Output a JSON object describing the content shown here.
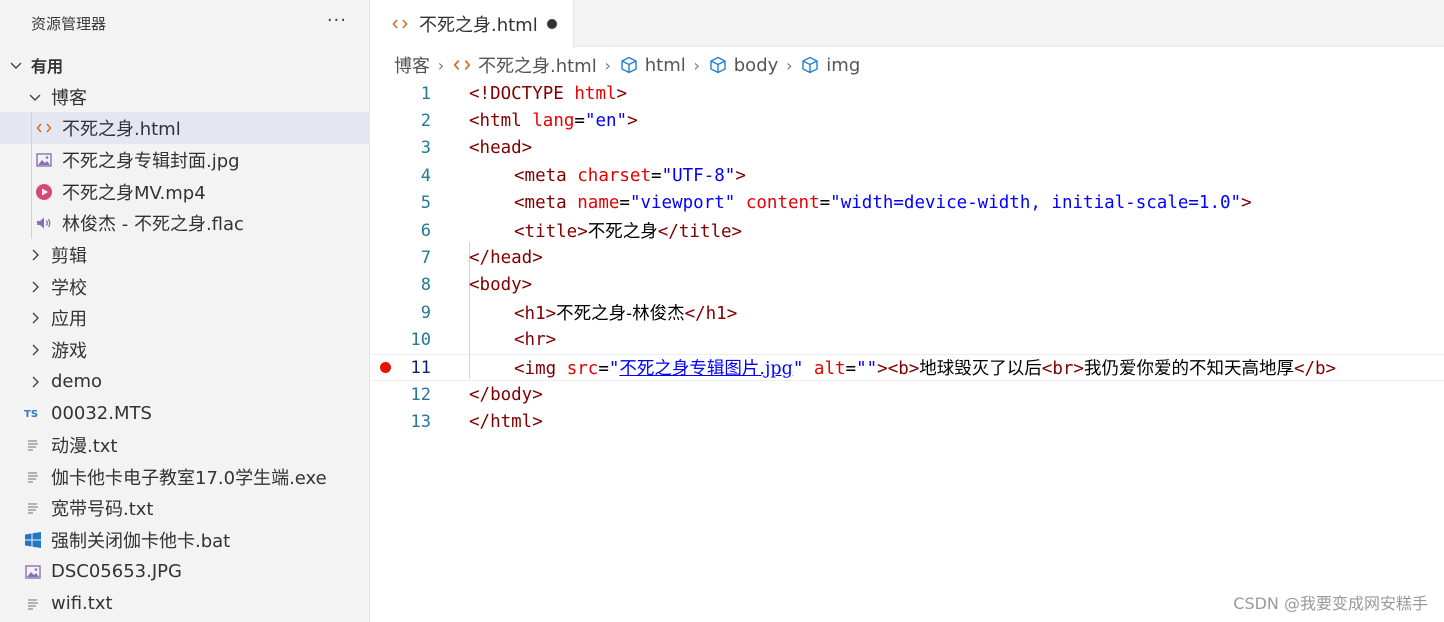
{
  "explorer": {
    "title": "资源管理器",
    "more": "···",
    "root": {
      "label": "有用"
    },
    "folder_blog": {
      "label": "博客"
    },
    "files_blog": [
      {
        "label": "不死之身.html",
        "icon": "html-code-icon",
        "selected": true
      },
      {
        "label": "不死之身专辑封面.jpg",
        "icon": "image-file-icon"
      },
      {
        "label": "不死之身MV.mp4",
        "icon": "video-play-icon"
      },
      {
        "label": "林俊杰 - 不死之身.flac",
        "icon": "audio-speaker-icon"
      }
    ],
    "folders": [
      "剪辑",
      "学校",
      "应用",
      "游戏",
      "demo"
    ],
    "files_root": [
      {
        "label": "00032.MTS",
        "icon": "ts-file-icon"
      },
      {
        "label": "动漫.txt",
        "icon": "text-file-icon"
      },
      {
        "label": "伽卡他卡电子教室17.0学生端.exe",
        "icon": "text-file-icon"
      },
      {
        "label": "宽带号码.txt",
        "icon": "text-file-icon"
      },
      {
        "label": "强制关闭伽卡他卡.bat",
        "icon": "windows-bat-icon"
      },
      {
        "label": "DSC05653.JPG",
        "icon": "image-file-icon"
      },
      {
        "label": "wifi.txt",
        "icon": "text-file-icon"
      }
    ]
  },
  "tab": {
    "label": "不死之身.html",
    "modified": true
  },
  "breadcrumb": [
    "博客",
    "不死之身.html",
    "html",
    "body",
    "img"
  ],
  "code": {
    "line_numbers": [
      "1",
      "2",
      "3",
      "4",
      "5",
      "6",
      "7",
      "8",
      "9",
      "10",
      "11",
      "12",
      "13"
    ],
    "active_line": "11",
    "l1": {
      "open": "<!",
      "kw": "DOCTYPE",
      "sp": " ",
      "name": "html",
      "close": ">"
    },
    "l2": {
      "open": "<",
      "tag": "html",
      "attr": "lang",
      "eq": "=",
      "val": "\"en\"",
      "close": ">"
    },
    "l3": {
      "text": "<head>"
    },
    "l4": {
      "open": "<",
      "tag": "meta",
      "attr": "charset",
      "eq": "=",
      "val": "\"UTF-8\"",
      "close": ">"
    },
    "l5": {
      "open": "<",
      "tag": "meta",
      "attr1": "name",
      "eq1": "=",
      "val1": "\"viewport\"",
      "attr2": "content",
      "eq2": "=",
      "val2": "\"width=device-width, initial-scale=1.0\"",
      "close": ">"
    },
    "l6": {
      "open": "<title>",
      "text": "不死之身",
      "close": "</title>"
    },
    "l7": {
      "text": "</head>"
    },
    "l8": {
      "text": "<body>"
    },
    "l9": {
      "open": "<h1>",
      "text": "不死之身-林俊杰",
      "close": "</h1>"
    },
    "l10": {
      "text": "<hr>"
    },
    "l11": {
      "open": "<img",
      "attr1": "src",
      "eq1": "=",
      "q1": "\"",
      "link": "不死之身专辑图片.jpg",
      "q2": "\"",
      "attr2": "alt",
      "eq2": "=",
      "val2": "\"\"",
      "close": ">",
      "b_open": "<b>",
      "text1": "地球毁灭了以后",
      "br": "<br>",
      "text2": "我仍爱你爱的不知天高地厚",
      "b_close": "</b>"
    },
    "l12": {
      "text": "</body>"
    },
    "l13": {
      "text": "</html>"
    }
  },
  "watermark": "CSDN @我要变成网安糕手"
}
